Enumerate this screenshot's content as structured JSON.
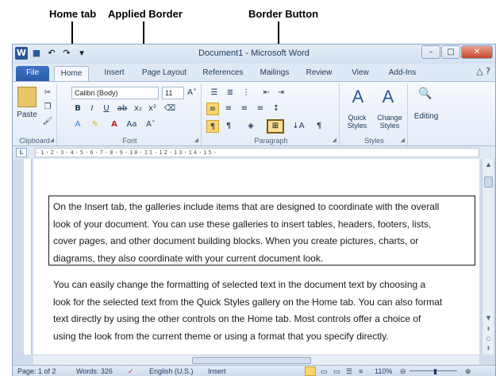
{
  "annotations": {
    "home_tab": "Home tab",
    "applied_border": "Applied Border",
    "border_button": "Border Button"
  },
  "window": {
    "title": "Document1 - Microsoft Word",
    "controls": {
      "minimize": "–",
      "maximize": "□",
      "close": "✕"
    }
  },
  "tabs": [
    "File",
    "Home",
    "Insert",
    "Page Layout",
    "References",
    "Mailings",
    "Review",
    "View",
    "Add-Ins"
  ],
  "ribbon": {
    "clipboard": {
      "paste": "Paste",
      "label": "Clipboard"
    },
    "font": {
      "font_name": "Calibri (Body)",
      "font_size": "11",
      "label": "Font"
    },
    "paragraph": {
      "label": "Paragraph"
    },
    "styles": {
      "quick_styles": "Quick Styles",
      "change_styles": "Change Styles",
      "label": "Styles"
    },
    "editing": {
      "label": "Editing"
    }
  },
  "document": {
    "paragraph1_lines": [
      "On the Insert tab, the galleries include items that are designed to coordinate with the overall",
      "look of your document. You can use these galleries to insert tables, headers, footers, lists,",
      "cover pages, and other document building blocks. When you create pictures, charts, or",
      "diagrams, they also coordinate with your current document look."
    ],
    "paragraph2_lines": [
      "You can easily change the formatting of selected text in the document text by choosing a",
      "look for the selected text from the Quick Styles gallery on the Home tab. You can also format",
      "text directly by using the other controls on the Home tab. Most controls offer a choice of",
      "using the look from the current theme or using a format that you specify directly."
    ]
  },
  "status_bar": {
    "page": "Page: 1 of 2",
    "words": "Words: 326",
    "language": "English (U.S.)",
    "mode": "Insert",
    "zoom": "110%"
  }
}
